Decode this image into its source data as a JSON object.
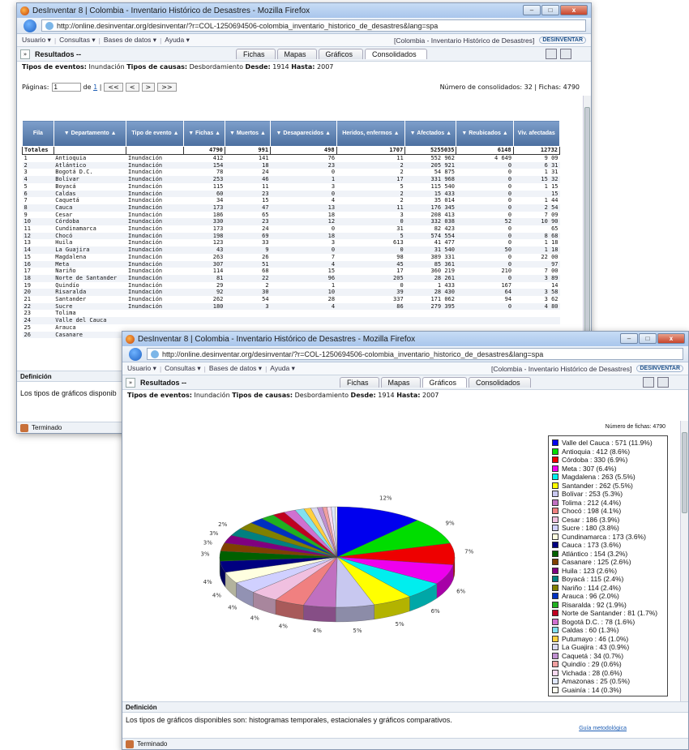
{
  "app": {
    "window_title": "DesInventar 8 | Colombia - Inventario Histórico de Desastres - Mozilla Firefox",
    "url1": "http://online.desinventar.org/desinventar/?r=COL-1250694506-colombia_inventario_historico_de_desastres&lang=spa",
    "url2": "http://online.desinventar.org/desinventar/?r=COL-1250694506-colombia_inventario_historico_de_desastres&lang=spa"
  },
  "menu": {
    "usuario": "Usuario",
    "consultas": "Consultas",
    "bases": "Bases de datos",
    "ayuda": "Ayuda",
    "region": "[Colombia - Inventario Histórico de Desastres]",
    "logo": "DESINVENTAR"
  },
  "results": {
    "title": "Resultados --",
    "tabs": [
      "Fichas",
      "Mapas",
      "Gráficos",
      "Consolidados"
    ],
    "filter": {
      "eventos_label": "Tipos de eventos:",
      "eventos": "Inundación",
      "causas_label": "Tipos de causas:",
      "causas": "Desbordamiento",
      "desde_label": "Desde:",
      "desde": "1914",
      "hasta_label": "Hasta:",
      "hasta": "2007"
    }
  },
  "pagination": {
    "label": "Páginas:",
    "value": "1",
    "de": "de",
    "total_pages": "1",
    "first": "<<",
    "prev": "<",
    "next": ">",
    "last": ">>",
    "summary": "Número de consolidados: 32 | Fichas: 4790"
  },
  "table": {
    "headers": [
      "Fila",
      "▼ Departamento ▲",
      "Tipo de evento ▲",
      "▼ Fichas ▲",
      "▼ Muertos ▲",
      "▼ Desaparecidos ▲",
      "Heridos, enfermos ▲",
      "▼ Afectados ▲",
      "▼ Reubicados ▲",
      "Viv. afectadas"
    ],
    "totals": [
      "Totales",
      "",
      "",
      "4790",
      "991",
      "498",
      "1707",
      "5255035",
      "6148",
      "12732"
    ],
    "rows": [
      [
        "1",
        "Antioquia",
        "Inundación",
        "412",
        "141",
        "76",
        "11",
        "552 962",
        "4 649",
        "9 09"
      ],
      [
        "2",
        "Atlántico",
        "Inundación",
        "154",
        "18",
        "23",
        "2",
        "205 921",
        "0",
        "6 31"
      ],
      [
        "3",
        "Bogotá D.C.",
        "Inundación",
        "78",
        "24",
        "0",
        "2",
        "54 875",
        "0",
        "1 31"
      ],
      [
        "4",
        "Bolívar",
        "Inundación",
        "253",
        "46",
        "1",
        "17",
        "331 968",
        "0",
        "15 32"
      ],
      [
        "5",
        "Boyacá",
        "Inundación",
        "115",
        "11",
        "3",
        "5",
        "115 540",
        "0",
        "1 15"
      ],
      [
        "6",
        "Caldas",
        "Inundación",
        "60",
        "23",
        "0",
        "2",
        "15 433",
        "0",
        "15"
      ],
      [
        "7",
        "Caquetá",
        "Inundación",
        "34",
        "15",
        "4",
        "2",
        "35 014",
        "0",
        "1 44"
      ],
      [
        "8",
        "Cauca",
        "Inundación",
        "173",
        "47",
        "13",
        "11",
        "176 345",
        "0",
        "2 54"
      ],
      [
        "9",
        "Cesar",
        "Inundación",
        "186",
        "65",
        "18",
        "3",
        "208 413",
        "0",
        "7 09"
      ],
      [
        "10",
        "Córdoba",
        "Inundación",
        "330",
        "23",
        "12",
        "0",
        "332 038",
        "52",
        "10 90"
      ],
      [
        "11",
        "Cundinamarca",
        "Inundación",
        "173",
        "24",
        "0",
        "31",
        "82 423",
        "0",
        "65"
      ],
      [
        "12",
        "Chocó",
        "Inundación",
        "198",
        "69",
        "18",
        "5",
        "574 554",
        "0",
        "8 68"
      ],
      [
        "13",
        "Huila",
        "Inundación",
        "123",
        "33",
        "3",
        "613",
        "41 477",
        "0",
        "1 18"
      ],
      [
        "14",
        "La Guajira",
        "Inundación",
        "43",
        "9",
        "0",
        "0",
        "31 540",
        "50",
        "1 18"
      ],
      [
        "15",
        "Magdalena",
        "Inundación",
        "263",
        "26",
        "7",
        "98",
        "389 331",
        "0",
        "22 00"
      ],
      [
        "16",
        "Meta",
        "Inundación",
        "307",
        "51",
        "4",
        "45",
        "85 361",
        "0",
        "97"
      ],
      [
        "17",
        "Nariño",
        "Inundación",
        "114",
        "68",
        "15",
        "17",
        "360 219",
        "210",
        "7 00"
      ],
      [
        "18",
        "Norte de Santander",
        "Inundación",
        "81",
        "22",
        "96",
        "205",
        "28 261",
        "0",
        "3 89"
      ],
      [
        "19",
        "Quindío",
        "Inundación",
        "29",
        "2",
        "1",
        "0",
        "1 433",
        "167",
        "14"
      ],
      [
        "20",
        "Risaralda",
        "Inundación",
        "92",
        "30",
        "10",
        "39",
        "28 430",
        "64",
        "3 58"
      ],
      [
        "21",
        "Santander",
        "Inundación",
        "262",
        "54",
        "28",
        "337",
        "171 062",
        "94",
        "3 62"
      ],
      [
        "22",
        "Sucre",
        "Inundación",
        "180",
        "3",
        "4",
        "86",
        "279 395",
        "0",
        "4 80"
      ],
      [
        "23",
        "Tolima",
        "",
        "",
        "",
        "",
        "",
        "",
        "",
        ""
      ],
      [
        "24",
        "Valle del Cauca",
        "",
        "",
        "",
        "",
        "",
        "",
        "",
        ""
      ],
      [
        "25",
        "Arauca",
        "",
        "",
        "",
        "",
        "",
        "",
        "",
        ""
      ],
      [
        "26",
        "Casanare",
        "",
        "",
        "",
        "",
        "",
        "",
        "",
        ""
      ]
    ]
  },
  "definicion": {
    "label": "Definición",
    "text_partial": "Los tipos de gráficos disponib",
    "text": "Los tipos de gráficos disponibles son: histogramas temporales, estacionales y gráficos comparativos.",
    "guia": "Guía metodológica"
  },
  "status": {
    "text": "Terminado"
  },
  "chart_header": {
    "numero_fichas": "Número de fichas: 4790"
  },
  "chart_data": {
    "type": "pie",
    "title": "",
    "total": 4790,
    "slice_labels": [
      "12%",
      "2%",
      "2%",
      "2%",
      "2%",
      "3%",
      "3%",
      "4%",
      "4%",
      "4%",
      "4%",
      "5%",
      "5%",
      "5%",
      "6%",
      "7%",
      "9%"
    ],
    "series": [
      {
        "label": "Valle del Cauca : 571 (11.9%)",
        "value": 571,
        "color": "#0000ee"
      },
      {
        "label": "Antioquia : 412 (8.6%)",
        "value": 412,
        "color": "#00dd00"
      },
      {
        "label": "Córdoba : 330 (6.9%)",
        "value": 330,
        "color": "#ee0000"
      },
      {
        "label": "Meta : 307 (6.4%)",
        "value": 307,
        "color": "#ee00ee"
      },
      {
        "label": "Magdalena : 263 (5.5%)",
        "value": 263,
        "color": "#00eeee"
      },
      {
        "label": "Santander : 262 (5.5%)",
        "value": 262,
        "color": "#ffff00"
      },
      {
        "label": "Bolívar : 253 (5.3%)",
        "value": 253,
        "color": "#c8c8f0"
      },
      {
        "label": "Tolima : 212 (4.4%)",
        "value": 212,
        "color": "#c070c0"
      },
      {
        "label": "Chocó : 198 (4.1%)",
        "value": 198,
        "color": "#f08080"
      },
      {
        "label": "Cesar : 186 (3.9%)",
        "value": 186,
        "color": "#f0c0e0"
      },
      {
        "label": "Sucre : 180 (3.8%)",
        "value": 180,
        "color": "#d0d0ff"
      },
      {
        "label": "Cundinamarca : 173 (3.6%)",
        "value": 173,
        "color": "#ffffe0"
      },
      {
        "label": "Cauca : 173 (3.6%)",
        "value": 173,
        "color": "#000080"
      },
      {
        "label": "Atlántico : 154 (3.2%)",
        "value": 154,
        "color": "#006000"
      },
      {
        "label": "Casanare : 125 (2.6%)",
        "value": 125,
        "color": "#804000"
      },
      {
        "label": "Huila : 123 (2.6%)",
        "value": 123,
        "color": "#800080"
      },
      {
        "label": "Boyacá : 115 (2.4%)",
        "value": 115,
        "color": "#008080"
      },
      {
        "label": "Nariño : 114 (2.4%)",
        "value": 114,
        "color": "#808000"
      },
      {
        "label": "Arauca : 96 (2.0%)",
        "value": 96,
        "color": "#0030c0"
      },
      {
        "label": "Risaralda : 92 (1.9%)",
        "value": 92,
        "color": "#20b020"
      },
      {
        "label": "Norte de Santander : 81 (1.7%)",
        "value": 81,
        "color": "#c00020"
      },
      {
        "label": "Bogotá D.C. : 78 (1.6%)",
        "value": 78,
        "color": "#d070d0"
      },
      {
        "label": "Caldas : 60 (1.3%)",
        "value": 60,
        "color": "#80e0f0"
      },
      {
        "label": "Putumayo : 46 (1.0%)",
        "value": 46,
        "color": "#ffd040"
      },
      {
        "label": "La Guajira : 43 (0.9%)",
        "value": 43,
        "color": "#d8d8f0"
      },
      {
        "label": "Caquetá : 34 (0.7%)",
        "value": 34,
        "color": "#c090d0"
      },
      {
        "label": "Quindío : 29 (0.6%)",
        "value": 29,
        "color": "#f0a0a0"
      },
      {
        "label": "Vichada : 28 (0.6%)",
        "value": 28,
        "color": "#f8d8f0"
      },
      {
        "label": "Amazonas : 25 (0.5%)",
        "value": 25,
        "color": "#e0e8ff"
      },
      {
        "label": "Guainía : 14 (0.3%)",
        "value": 14,
        "color": "#fffff0"
      }
    ]
  }
}
